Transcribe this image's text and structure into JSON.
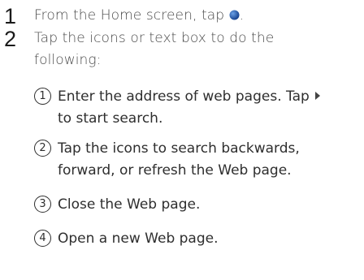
{
  "steps": [
    {
      "num": "1",
      "text_before": "From the Home screen, tap",
      "text_after": ".",
      "icon": "globe-icon"
    },
    {
      "num": "2",
      "line1": "Tap the icons or text box to do the",
      "line2": "following:"
    }
  ],
  "items": [
    {
      "num": "1",
      "line1": "Enter the address of web pages. Tap",
      "line2": "to start search.",
      "icon": "play-triangle-icon"
    },
    {
      "num": "2",
      "line1": "Tap the icons to search backwards,",
      "line2": "forward, or refresh the Web page."
    },
    {
      "num": "3",
      "line1": "Close the Web page."
    },
    {
      "num": "4",
      "line1": "Open a new Web page."
    }
  ]
}
